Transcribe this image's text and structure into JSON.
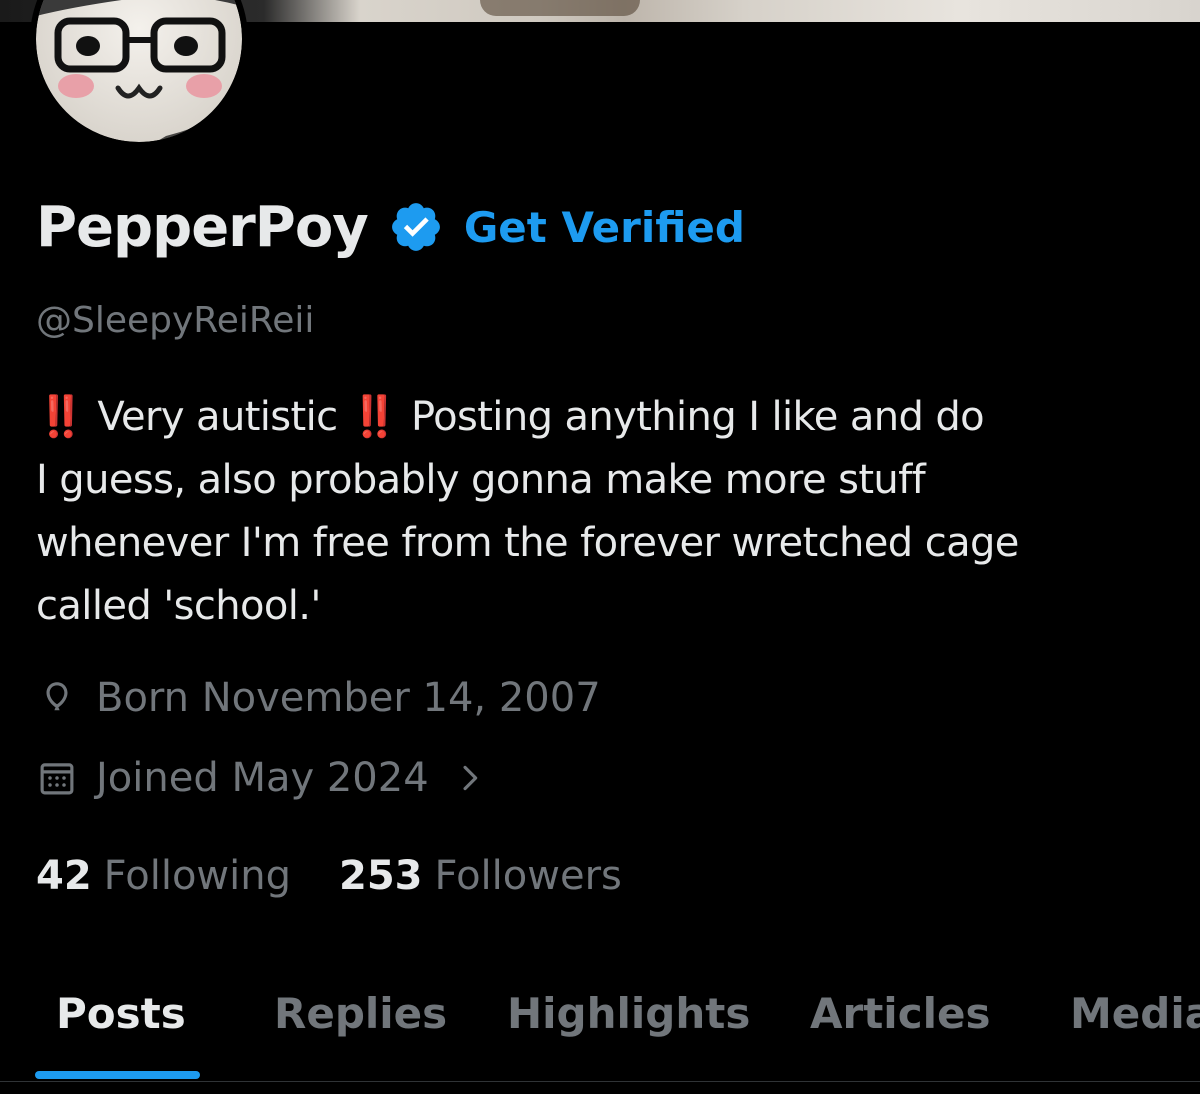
{
  "profile": {
    "display_name": "PepperPoy",
    "get_verified_label": "Get Verified",
    "handle": "@SleepyReiReii",
    "bio": {
      "bang": "‼️",
      "text_1": "Very autistic",
      "text_2": "Posting anything I like and do",
      "text_3": "I guess, also probably gonna make more stuff",
      "text_4": "whenever I'm free from the forever wretched cage",
      "text_5": "called 'school.'"
    },
    "birth": "Born November 14, 2007",
    "joined": "Joined May 2024",
    "following": {
      "count": "42",
      "label": "Following"
    },
    "followers": {
      "count": "253",
      "label": "Followers"
    }
  },
  "tabs": [
    {
      "label": "Posts",
      "active": true
    },
    {
      "label": "Replies",
      "active": false
    },
    {
      "label": "Highlights",
      "active": false
    },
    {
      "label": "Articles",
      "active": false
    },
    {
      "label": "Media",
      "active": false
    }
  ],
  "icons": {
    "verified": "verified-badge-icon",
    "birth": "balloon-icon",
    "joined": "calendar-icon",
    "chevron": "chevron-right-icon"
  },
  "colors": {
    "accent": "#1d9bf0",
    "secondary_text": "#71767b",
    "primary_text": "#e7e9ea",
    "background": "#000000",
    "bang": "#e0245e"
  }
}
